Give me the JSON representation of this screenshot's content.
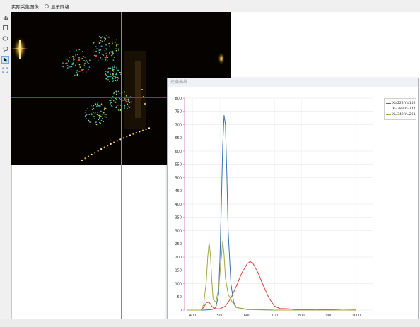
{
  "caption": {
    "label": "实际采集图像",
    "grid_toggle_label": "显示网格",
    "grid_toggle_checked": false
  },
  "tools": [
    {
      "name": "hand-tool-icon",
      "active": false
    },
    {
      "name": "rectangle-tool-icon",
      "active": false
    },
    {
      "name": "ellipse-tool-icon",
      "active": false
    },
    {
      "name": "lasso-tool-icon",
      "active": false
    },
    {
      "name": "pointer-tool-icon",
      "active": true
    },
    {
      "name": "fit-view-icon",
      "active": false
    }
  ],
  "spectrum_window": {
    "title": "光谱曲线"
  },
  "chart_data": {
    "type": "line",
    "xlim": [
      370,
      1060
    ],
    "ylim": [
      0,
      800
    ],
    "x_ticks": [
      400,
      500,
      600,
      700,
      800,
      900,
      1000
    ],
    "y_ticks": [
      0,
      50,
      100,
      150,
      200,
      250,
      300,
      350,
      400,
      450,
      500,
      550,
      600,
      650,
      700,
      750,
      800
    ],
    "grid": true,
    "legend_position": "top-right",
    "series": [
      {
        "name": "X=222,Y=152",
        "color": "#3a6fb5",
        "points": [
          [
            380,
            0
          ],
          [
            440,
            0
          ],
          [
            470,
            2
          ],
          [
            485,
            10
          ],
          [
            495,
            60
          ],
          [
            500,
            200
          ],
          [
            505,
            400
          ],
          [
            510,
            620
          ],
          [
            515,
            735
          ],
          [
            520,
            700
          ],
          [
            525,
            520
          ],
          [
            530,
            300
          ],
          [
            540,
            100
          ],
          [
            550,
            30
          ],
          [
            560,
            10
          ],
          [
            600,
            3
          ],
          [
            700,
            0
          ],
          [
            1000,
            0
          ]
        ]
      },
      {
        "name": "X=389,Y=144",
        "color": "#d04a3a",
        "points": [
          [
            380,
            0
          ],
          [
            430,
            0
          ],
          [
            440,
            10
          ],
          [
            450,
            28
          ],
          [
            460,
            30
          ],
          [
            470,
            15
          ],
          [
            480,
            5
          ],
          [
            500,
            5
          ],
          [
            520,
            15
          ],
          [
            540,
            45
          ],
          [
            560,
            90
          ],
          [
            580,
            140
          ],
          [
            600,
            175
          ],
          [
            610,
            183
          ],
          [
            620,
            178
          ],
          [
            640,
            140
          ],
          [
            660,
            90
          ],
          [
            680,
            45
          ],
          [
            700,
            15
          ],
          [
            720,
            6
          ],
          [
            750,
            5
          ],
          [
            780,
            2
          ],
          [
            820,
            3
          ],
          [
            850,
            1
          ],
          [
            900,
            2
          ],
          [
            950,
            0
          ],
          [
            1000,
            1
          ]
        ]
      },
      {
        "name": "X=342,Y=261",
        "color": "#9fa840",
        "points": [
          [
            380,
            0
          ],
          [
            430,
            0
          ],
          [
            440,
            20
          ],
          [
            450,
            110
          ],
          [
            455,
            200
          ],
          [
            460,
            255
          ],
          [
            465,
            210
          ],
          [
            470,
            110
          ],
          [
            475,
            40
          ],
          [
            485,
            30
          ],
          [
            495,
            80
          ],
          [
            505,
            200
          ],
          [
            510,
            260
          ],
          [
            515,
            210
          ],
          [
            520,
            120
          ],
          [
            530,
            60
          ],
          [
            545,
            30
          ],
          [
            560,
            10
          ],
          [
            600,
            2
          ],
          [
            700,
            0
          ],
          [
            1000,
            0
          ]
        ]
      }
    ]
  }
}
